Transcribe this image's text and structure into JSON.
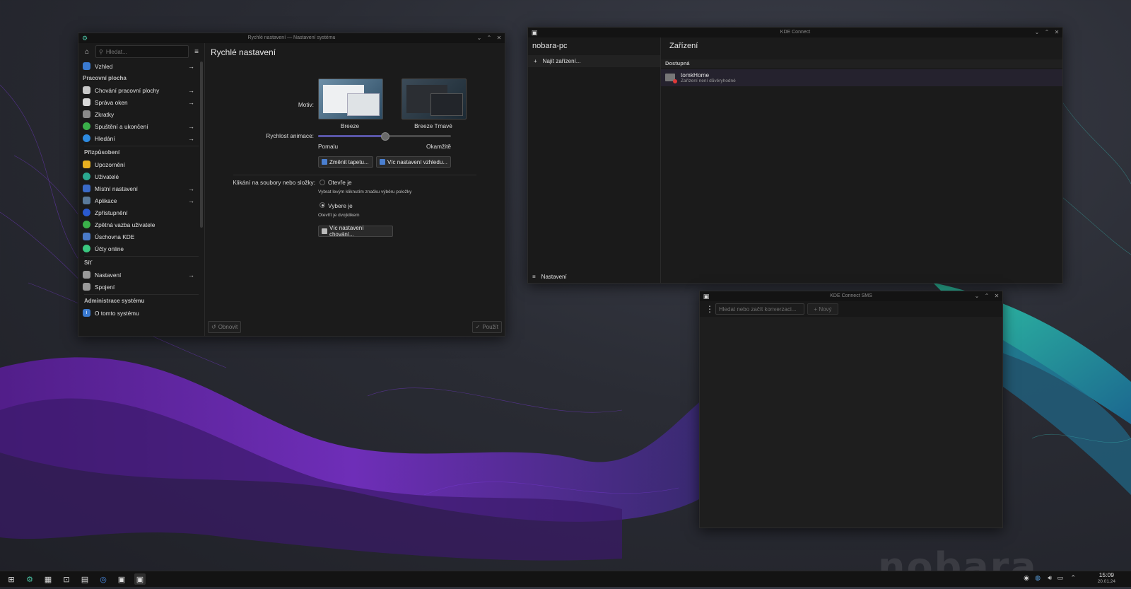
{
  "settings": {
    "title": "Rychlé nastavení — Nastavení systému",
    "search_placeholder": "Hledat...",
    "page_title": "Rychlé nastavení",
    "motif_label": "Motiv:",
    "theme_light": "Breeze",
    "theme_dark": "Breeze Tmavé",
    "anim_label": "Rychlost animace:",
    "anim_slow": "Pomalu",
    "anim_fast": "Okamžitě",
    "anim_value": 0.5,
    "btn_wallpaper": "Změnit tapetu...",
    "btn_more_look": "Víc nastavení vzhledu...",
    "click_label": "Klikání na soubory nebo složky:",
    "opt_open": "Otevře je",
    "opt_open_hint": "Vybrat levým kliknutím značku výběru položky",
    "opt_select": "Vybere je",
    "opt_select_hint": "Otevřít je dvojklikem",
    "btn_more_behavior": "Víc nastavení chování...",
    "btn_reset": "Obnovit",
    "btn_apply": "Použít",
    "sidebar": {
      "appearance": "Vzhled",
      "cat_workspace": "Pracovní plocha",
      "desktop_behavior": "Chování pracovní plochy",
      "window_mgmt": "Správa oken",
      "shortcuts": "Zkratky",
      "startup": "Spuštění a ukončení",
      "search": "Hledání",
      "cat_personal": "Přizpůsobení",
      "notifications": "Upozornění",
      "users": "Uživatelé",
      "regional": "Místní nastavení",
      "apps": "Aplikace",
      "accessibility": "Zpřístupnění",
      "feedback": "Zpětná vazba uživatele",
      "kwallet": "Úschovna KDE",
      "online_accounts": "Účty online",
      "cat_network": "Síť",
      "net_settings": "Nastavení",
      "connections": "Spojení",
      "cat_admin": "Administrace systému",
      "about": "O tomto systému"
    }
  },
  "kdeconnect": {
    "title": "KDE Connect",
    "hostname": "nobara-pc",
    "find_devices": "Najít zařízení...",
    "devices_title": "Zařízení",
    "available": "Dostupná",
    "device_name": "tomkHome",
    "device_status": "Zařízení není důvěryhodné",
    "settings": "Nastavení"
  },
  "sms": {
    "title": "KDE Connect SMS",
    "search_placeholder": "Hledat nebo začít konverzaci...",
    "new_button": "Nový"
  },
  "wallpaper_logo": "nobara",
  "taskbar": {
    "time": "15:09",
    "date": "20.01.24"
  },
  "colors": {
    "accent": "#5a56a8",
    "window_bg": "#1b1b1b",
    "titlebar_bg": "#131313"
  }
}
